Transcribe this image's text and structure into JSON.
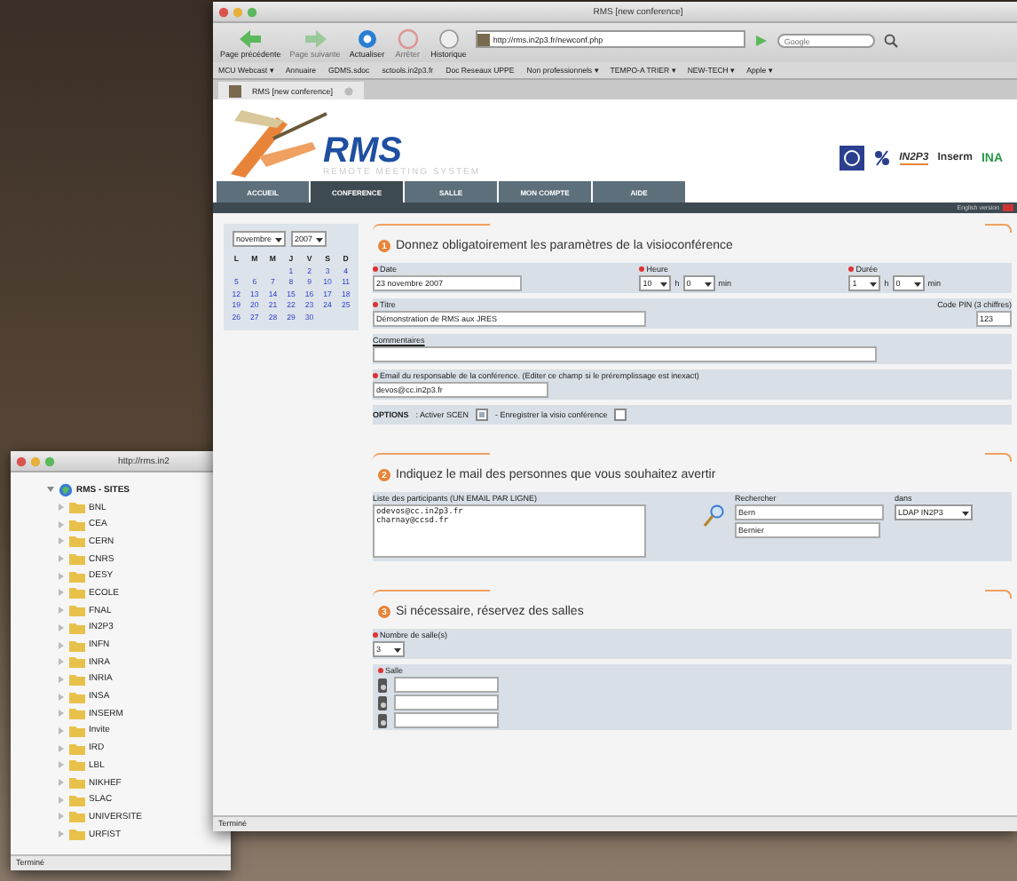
{
  "side_window": {
    "title": "http://rms.in2",
    "tree": [
      {
        "label": "RMS - SITES",
        "expanded": true,
        "children": [
          {
            "label": "BNL"
          },
          {
            "label": "CEA"
          },
          {
            "label": "CERN"
          },
          {
            "label": "CNRS"
          },
          {
            "label": "DESY"
          },
          {
            "label": "ECOLE"
          },
          {
            "label": "FNAL"
          },
          {
            "label": "IN2P3"
          },
          {
            "label": "INFN"
          },
          {
            "label": "INRA"
          },
          {
            "label": "INRIA"
          },
          {
            "label": "INSA"
          },
          {
            "label": "INSERM"
          },
          {
            "label": "Invite"
          },
          {
            "label": "IRD"
          },
          {
            "label": "LBL"
          },
          {
            "label": "NIKHEF"
          },
          {
            "label": "SLAC"
          },
          {
            "label": "UNIVERSITE"
          },
          {
            "label": "URFIST"
          }
        ]
      }
    ],
    "status_bar": "Terminé"
  },
  "window": {
    "title": "RMS [new conference]"
  },
  "toolbar": [
    {
      "label": "Page précédente",
      "kind": "back",
      "disabled": false
    },
    {
      "label": "Page suivante",
      "kind": "forward",
      "disabled": true
    },
    {
      "label": "Actualiser",
      "kind": "reload",
      "disabled": false
    },
    {
      "label": "Arrêter",
      "kind": "stop",
      "disabled": true
    },
    {
      "label": "Historique",
      "kind": "history",
      "disabled": false
    }
  ],
  "address": "http://rms.in2p3.fr/newconf.php",
  "search": {
    "placeholder": "Google"
  },
  "bookmarks": [
    "MCU Webcast ▾",
    "Annuaire",
    "GDMS.sdoc",
    "sctools.in2p3.fr",
    "Doc Reseaux UPPE",
    "Non professionnels ▾",
    "TEMPO-A TRIER ▾",
    "NEW-TECH ▾",
    "Apple ▾"
  ],
  "tabs": [
    {
      "label": "RMS [new conference]",
      "selected": true
    }
  ],
  "site": {
    "logo": "RMS",
    "tagline": "REMOTE MEETING SYSTEM",
    "partners": [
      "IN2P3",
      "Inserm",
      "INA"
    ],
    "nav": [
      {
        "label": "ACCUEIL",
        "selected": false
      },
      {
        "label": "CONFERENCE",
        "selected": true
      },
      {
        "label": "SALLE",
        "selected": false
      },
      {
        "label": "MON COMPTE",
        "selected": false
      },
      {
        "label": "AIDE",
        "selected": false
      }
    ],
    "language_link": "English version"
  },
  "calendar": {
    "month": "novembre",
    "year": "2007",
    "weekdays": [
      "L",
      "M",
      "M",
      "J",
      "V",
      "S",
      "D"
    ],
    "weeks": [
      {
        "kind": "leading",
        "days": [
          "1",
          "2",
          "3",
          "4"
        ]
      },
      {
        "kind": "full",
        "days": [
          "5",
          "6",
          "7",
          "8",
          "9",
          "10",
          "11"
        ]
      },
      {
        "kind": "full",
        "days": [
          "12",
          "13",
          "14",
          "15",
          "16",
          "17",
          "18"
        ]
      },
      {
        "kind": "full",
        "days": [
          "19",
          "20",
          "21",
          "22",
          "23",
          "24",
          "25"
        ]
      },
      {
        "kind": "full",
        "days": [
          "26",
          "27",
          "28",
          "29",
          "30"
        ]
      }
    ]
  },
  "sections": [
    {
      "number": "1",
      "title": "Donnez obligatoirement les paramètres de la visioconférence",
      "kind": "parameters",
      "date": {
        "label": "Date",
        "value": "23 novembre 2007"
      },
      "time": {
        "label": "Heure",
        "hours": "10",
        "h": "h",
        "minutes": "0",
        "unit": "min"
      },
      "duration": {
        "label": "Durée",
        "hours": "1",
        "h": "h",
        "minutes": "0",
        "unit": "min"
      },
      "title_field": {
        "label": "Titre",
        "value": "Démonstration de RMS aux JRES"
      },
      "pin": {
        "label": "Code PIN (3 chiffres)",
        "value": "123"
      },
      "comments": {
        "label": "Commentaires"
      },
      "email": {
        "label": "Email du responsable de la conférence. (Editer ce champ si le préremplissage est inexact)",
        "value": "devos@cc.in2p3.fr"
      },
      "options": {
        "label": "OPTIONS",
        "items": [
          {
            "label": ": Activer SCEN",
            "checked": true
          },
          {
            "label": "- Enregistrer la visio conférence",
            "checked": false
          }
        ]
      }
    },
    {
      "number": "2",
      "title": "Indiquez le mail des personnes que vous souhaitez avertir",
      "kind": "participants",
      "list": {
        "label": "Liste des participants (UN EMAIL PAR LIGNE)",
        "value": "odevos@cc.in2p3.fr\ncharnay@ccsd.fr"
      },
      "search": {
        "label": "Rechercher",
        "value": "Bern",
        "suggestion": "Bernier"
      },
      "scope": {
        "label": "dans",
        "value": "LDAP IN2P3"
      }
    },
    {
      "number": "3",
      "title": "Si nécessaire, réservez des salles",
      "kind": "rooms",
      "count": {
        "label": "Nombre de salle(s)",
        "value": "3"
      },
      "rooms": {
        "label": "Salle",
        "fields": [
          {
            "kind": "room"
          },
          {
            "kind": "room"
          },
          {
            "kind": "room"
          }
        ]
      }
    }
  ],
  "status_bar": "Terminé"
}
